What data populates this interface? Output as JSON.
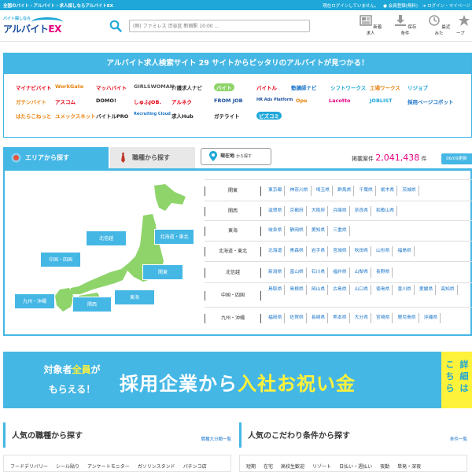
{
  "topbar": {
    "tagline": "全国のバイト・アルバイト・求人探しならアルバイトEX",
    "login_status": "現在ログインしていません。",
    "register": "会員登録(無料)",
    "login": "ログイン・マイページ"
  },
  "header": {
    "logo_small": "バイト探しなら",
    "logo_main": "アルバイト",
    "logo_ex": "EX",
    "search_placeholder": "(例) ファミレス 渋谷区 新宿駅 10:00 ...",
    "buttons": [
      {
        "label": "新着求人",
        "icon": "newspaper-icon"
      },
      {
        "label": "保存条件",
        "icon": "download-icon"
      },
      {
        "label": "最近みた",
        "icon": "clock-icon"
      },
      {
        "label": "キープ",
        "icon": "star-icon"
      }
    ]
  },
  "hero": {
    "title": "アルバイト求人検索サイト 29 サイトからピッタリのアルバイトが見つかる！",
    "sites": [
      {
        "name": "マイナビバイト",
        "color": "#e60012",
        "icon": "mynavi-logo"
      },
      {
        "name": "WorkGate",
        "color": "#e8820e",
        "icon": "workgate-logo"
      },
      {
        "name": "マッハバイト",
        "color": "#e60012",
        "icon": "machbaito-logo"
      },
      {
        "name": "GIRLSWOMAN",
        "color": "#555555",
        "icon": "girlswoman-logo"
      },
      {
        "name": "介護求人ナビ",
        "color": "#333333",
        "icon": "kaigo-logo"
      },
      {
        "name": "バイト",
        "color": "#ffffff",
        "icon": "baito-logo"
      },
      {
        "name": "バイトル",
        "color": "#e60012",
        "icon": "baitoru-logo"
      },
      {
        "name": "塾講師ナビ",
        "color": "#1b75c9",
        "icon": "jukukoshi-logo"
      },
      {
        "name": "シフトワークス",
        "color": "#1ea7d8",
        "icon": "shiftworks-logo"
      },
      {
        "name": "工場ワークス",
        "color": "#e8820e",
        "icon": "kojo-logo"
      },
      {
        "name": "リジョブ",
        "color": "#1ea7d8",
        "icon": "rejob-logo"
      },
      {
        "name": "ガテンバイト",
        "color": "#e8820e",
        "icon": "gaten-logo"
      },
      {
        "name": "アスコム",
        "color": "#e60012",
        "icon": "ascom-logo"
      },
      {
        "name": "DOMO!",
        "color": "#222222",
        "icon": "domo-logo"
      },
      {
        "name": "しゅふJOB.",
        "color": "#e60012",
        "icon": "shufujob-logo"
      },
      {
        "name": "アルネク",
        "color": "#e60012",
        "icon": "aruneku-logo"
      },
      {
        "name": "FROM JOB",
        "color": "#1b4f9c",
        "icon": "fromjob-logo"
      },
      {
        "name": "HR Ads Platform",
        "color": "#1b4f9c",
        "icon": "hrads-logo"
      },
      {
        "name": "Ope",
        "color": "#e8820e",
        "icon": "ope-logo"
      },
      {
        "name": "Lacotto",
        "color": "#e4007f",
        "icon": "lacotto-logo"
      },
      {
        "name": "JOBLIST",
        "color": "#1ea7d8",
        "icon": "joblist-logo"
      },
      {
        "name": "採用ページコボット",
        "color": "#1b75c9",
        "icon": "cobot-logo"
      },
      {
        "name": "はたらこねっと",
        "color": "#e8820e",
        "icon": "hatarako-logo"
      },
      {
        "name": "ユメックスネット",
        "color": "#e8820e",
        "icon": "yumex-logo"
      },
      {
        "name": "バイトルPRO",
        "color": "#222222",
        "icon": "baitorupro-logo"
      },
      {
        "name": "Recruiting Cloud",
        "color": "#1b75c9",
        "icon": "recruitingcloud-logo"
      },
      {
        "name": "求人Hub",
        "color": "#222222",
        "icon": "kyujinhub-logo"
      },
      {
        "name": "ガテライト",
        "color": "#222222",
        "icon": "gatelite-logo"
      },
      {
        "name": "ビズコミ",
        "color": "#ffffff",
        "icon": "bizcomi-logo"
      }
    ]
  },
  "search_tabs": {
    "area": "エリアから探す",
    "job": "職種から探す",
    "location_main": "現在地",
    "location_sub": "から探す"
  },
  "listing": {
    "label": "掲載案件",
    "count": "2,041,438",
    "unit": "件",
    "updated": "06/09更新"
  },
  "map_regions": [
    "北信越",
    "北海道・東北",
    "中国・四国",
    "関東",
    "九州・沖縄",
    "関西",
    "東海"
  ],
  "regions": [
    {
      "name": "関東",
      "prefs": [
        "東京都",
        "神奈川県",
        "埼玉県",
        "群馬県",
        "千葉県",
        "栃木県",
        "茨城県"
      ]
    },
    {
      "name": "関西",
      "prefs": [
        "滋賀県",
        "京都府",
        "大阪府",
        "兵庫県",
        "奈良県",
        "和歌山県"
      ]
    },
    {
      "name": "東海",
      "prefs": [
        "岐阜県",
        "静岡県",
        "愛知県",
        "三重県"
      ]
    },
    {
      "name": "北海道・東北",
      "prefs": [
        "北海道",
        "青森県",
        "岩手県",
        "宮城県",
        "秋田県",
        "山形県",
        "福島県"
      ]
    },
    {
      "name": "北信越",
      "prefs": [
        "新潟県",
        "富山県",
        "石川県",
        "福井県",
        "山梨県",
        "長野県"
      ]
    },
    {
      "name": "中国・四国",
      "prefs": [
        "鳥取県",
        "島根県",
        "岡山県",
        "広島県",
        "山口県",
        "徳島県",
        "香川県",
        "愛媛県",
        "高知県"
      ]
    },
    {
      "name": "九州・沖縄",
      "prefs": [
        "福岡県",
        "佐賀県",
        "長崎県",
        "熊本県",
        "大分県",
        "宮崎県",
        "鹿児島県",
        "沖縄県"
      ]
    }
  ],
  "banner": {
    "line1_pre": "対象者",
    "line1_hl": "全員",
    "line1_post": "が",
    "line2": "もらえる！",
    "main_pre": "採用企業から",
    "main_hl": "入社お祝い金",
    "side_col1": "こちら",
    "side_col2": "詳細は"
  },
  "popular_jobs": {
    "title": "人気の職種から探す",
    "link": "職種大分類一覧",
    "tags": [
      "フードデリバリー",
      "シール貼り",
      "アンケートモニター",
      "ガソリンスタンド",
      "パチンコ店"
    ]
  },
  "popular_conditions": {
    "title": "人気のこだわり条件から探す",
    "link": "条件一覧",
    "tags": [
      "短期",
      "在宅",
      "高校生歓迎",
      "リゾート",
      "日払い・週払い",
      "夜勤",
      "単発・深夜"
    ]
  },
  "colors": {
    "accent": "#45b7e5",
    "brand": "#1b4f9c",
    "count": "#e4007f",
    "highlight": "#fff23a",
    "map": "#8ed46a"
  }
}
